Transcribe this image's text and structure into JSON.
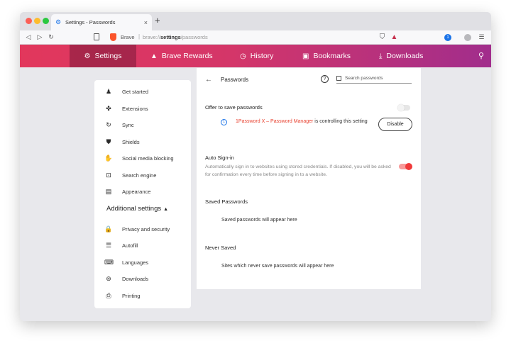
{
  "tab": {
    "title": "Settings - Passwords",
    "close": "×"
  },
  "urlbar": {
    "brave_label": "Brave",
    "separator": "|",
    "scheme": "brave://",
    "host": "settings",
    "path": "/passwords",
    "nav": {
      "back": "◁",
      "forward": "▷",
      "reload": "↻"
    }
  },
  "bravenav": {
    "items": [
      {
        "label": "Settings",
        "icon": "gear-icon",
        "glyph": "⚙",
        "active": true
      },
      {
        "label": "Brave Rewards",
        "icon": "triangle-icon",
        "glyph": "▲",
        "active": false
      },
      {
        "label": "History",
        "icon": "clock-icon",
        "glyph": "◷",
        "active": false
      },
      {
        "label": "Bookmarks",
        "icon": "bookmark-icon",
        "glyph": "▣",
        "active": false
      },
      {
        "label": "Downloads",
        "icon": "download-icon",
        "glyph": "⤓",
        "active": false
      }
    ],
    "search_glyph": "⚲"
  },
  "sidebar": {
    "items": [
      {
        "label": "Get started",
        "icon": "person-icon",
        "glyph": "♟"
      },
      {
        "label": "Extensions",
        "icon": "puzzle-icon",
        "glyph": "✤"
      },
      {
        "label": "Sync",
        "icon": "sync-icon",
        "glyph": "↻"
      },
      {
        "label": "Shields",
        "icon": "shield-icon",
        "glyph": "⛊"
      },
      {
        "label": "Social media blocking",
        "icon": "thumbs-down-icon",
        "glyph": "✋"
      },
      {
        "label": "Search engine",
        "icon": "search-engine-icon",
        "glyph": "⊡"
      },
      {
        "label": "Appearance",
        "icon": "appearance-icon",
        "glyph": "▤"
      }
    ],
    "additional_heading": "Additional settings",
    "additional_caret": "▲",
    "additional_items": [
      {
        "label": "Privacy and security",
        "icon": "lock-icon",
        "glyph": "🔒"
      },
      {
        "label": "Autofill",
        "icon": "list-icon",
        "glyph": "☰"
      },
      {
        "label": "Languages",
        "icon": "language-icon",
        "glyph": "⌨"
      },
      {
        "label": "Downloads",
        "icon": "download-circle-icon",
        "glyph": "⊛"
      },
      {
        "label": "Printing",
        "icon": "printer-icon",
        "glyph": "⎙"
      }
    ]
  },
  "passwords": {
    "back_glyph": "←",
    "title": "Passwords",
    "help_glyph": "?",
    "search_placeholder": "Search passwords",
    "offer_label": "Offer to save passwords",
    "offer_enabled": false,
    "controlled_by_link": "1Password X – Password Manager",
    "controlled_text": " is controlling this setting",
    "disable_label": "Disable",
    "autosign_label": "Auto Sign-in",
    "autosign_desc": "Automatically sign in to websites using stored credentials. If disabled, you will be asked for confirmation every time before signing in to a website.",
    "autosign_enabled": true,
    "saved_heading": "Saved Passwords",
    "saved_empty": "Saved passwords will appear here",
    "never_heading": "Never Saved",
    "never_empty": "Sites which never save passwords will appear here"
  },
  "colors": {
    "accent": "#e2375c",
    "toggle_on": "#f03a3a",
    "link": "#e8412f"
  }
}
